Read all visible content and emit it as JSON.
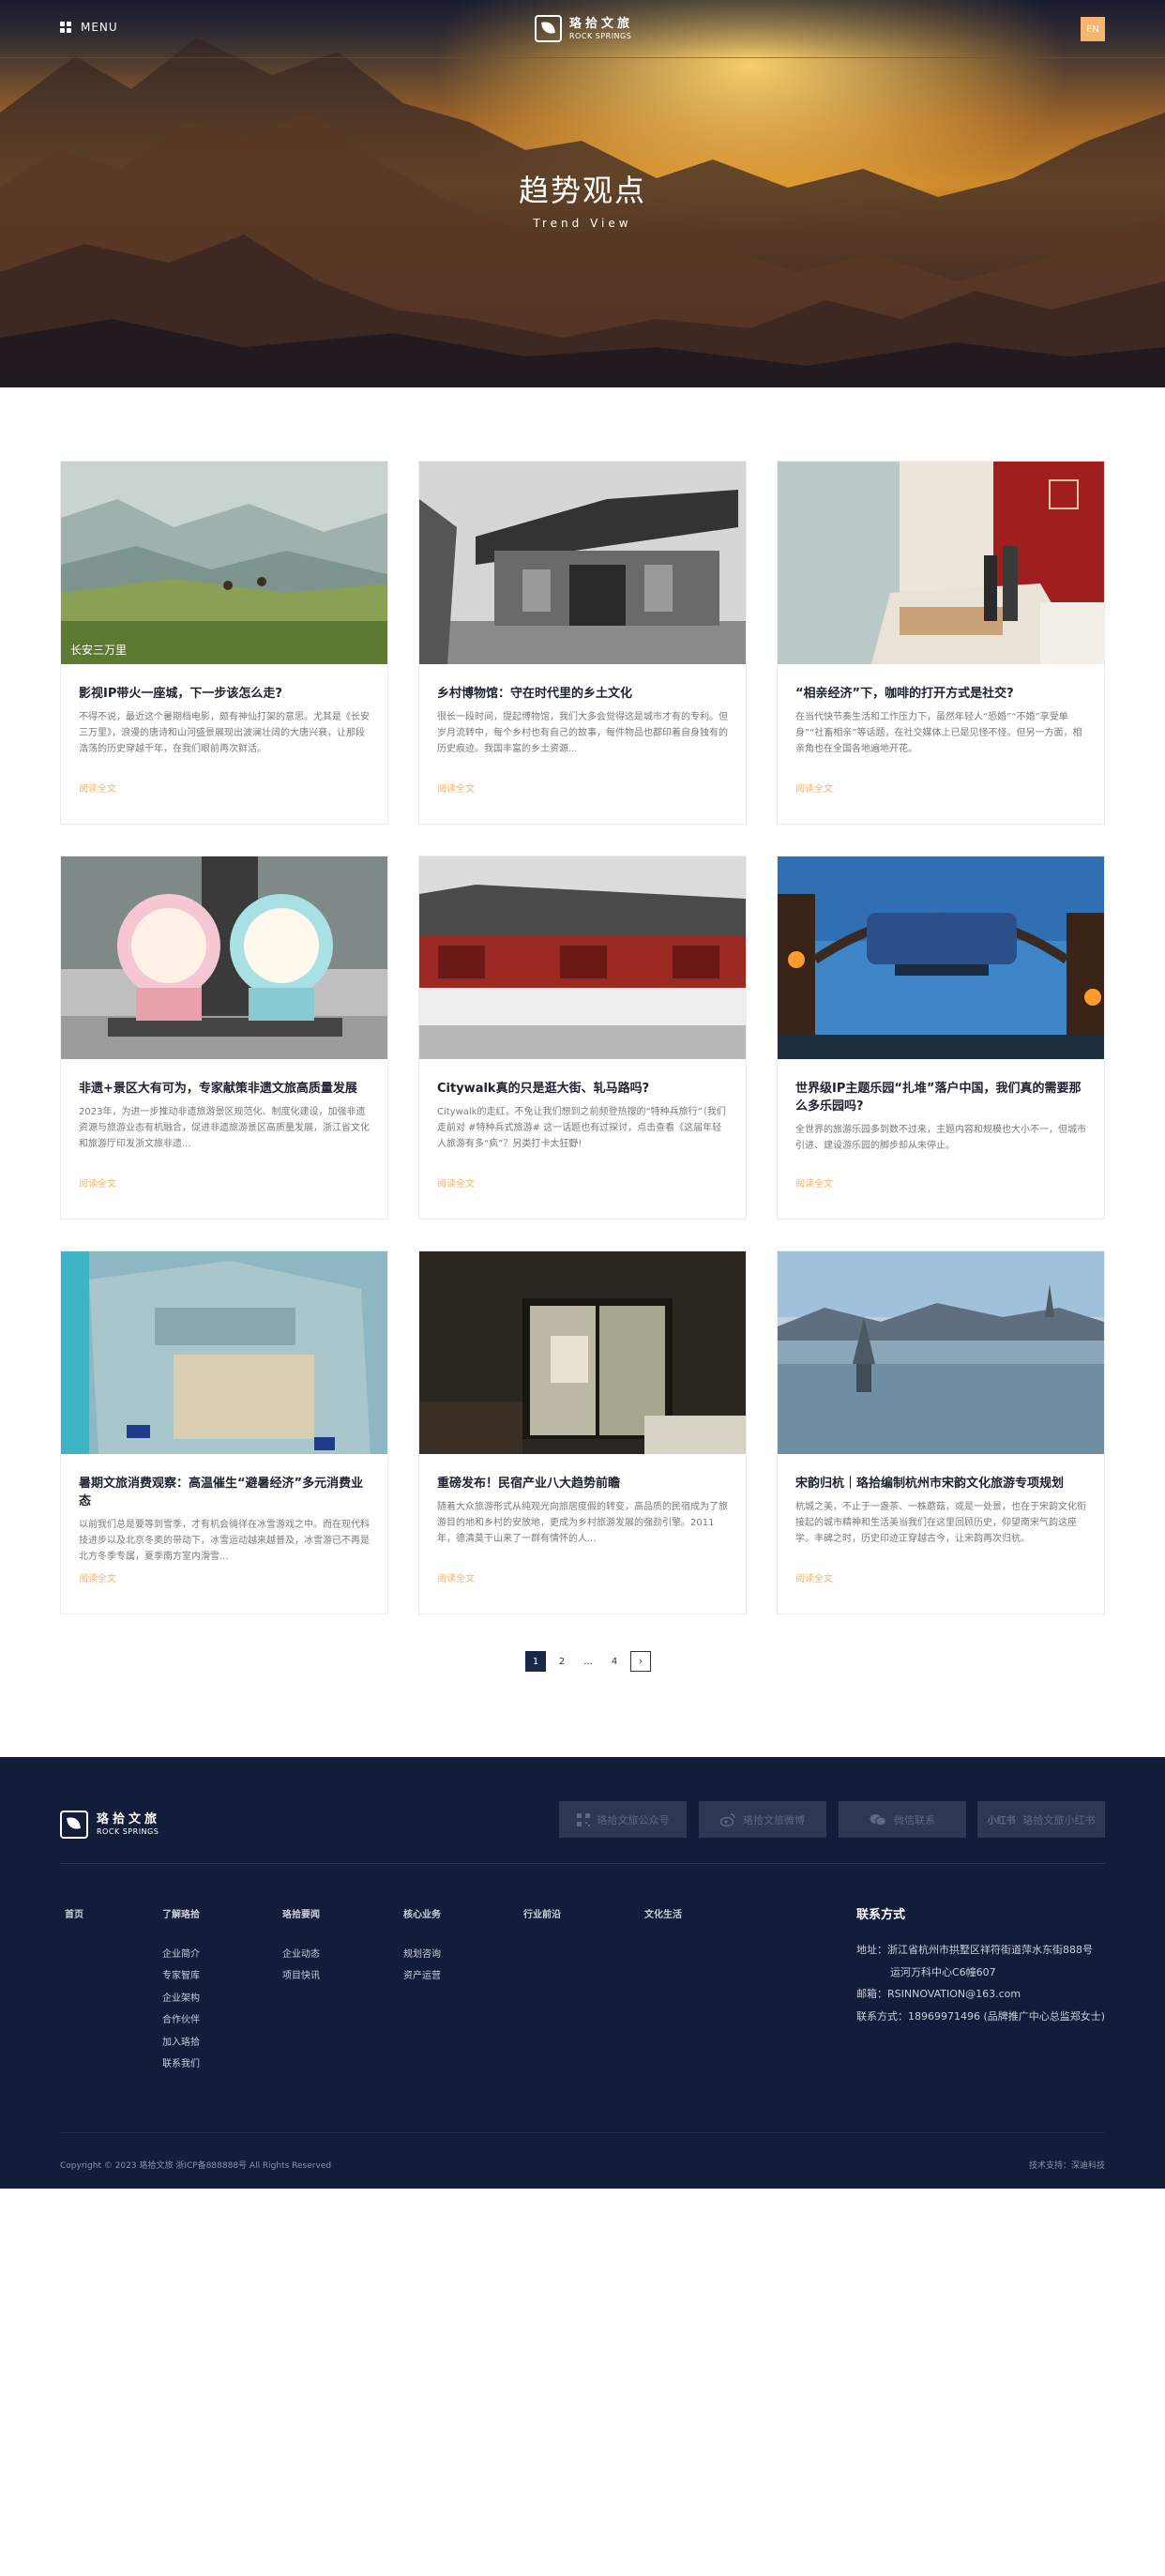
{
  "header": {
    "menu_label": "MENU",
    "logo_cn": "珞拾文旅",
    "logo_en": "ROCK SPRINGS",
    "lang_label": "EN"
  },
  "hero": {
    "title": "趋势观点",
    "subtitle": "Trend View"
  },
  "articles": [
    {
      "title": "影视IP带火一座城，下一步该怎么走?",
      "excerpt": "不得不说，最近这个暑期档电影，颇有神仙打架的意思。尤其是《长安三万里》，浪漫的唐诗和山河盛景展现出波澜壮阔的大唐兴衰，让那段浩荡的历史穿越千年，在我们眼前再次鲜活。",
      "more": "阅读全文"
    },
    {
      "title": "乡村博物馆：守在时代里的乡土文化",
      "excerpt": "很长一段时间，提起博物馆，我们大多会觉得这是城市才有的专利。但岁月流转中，每个乡村也有自己的故事，每件物品也都印着自身独有的历史痕迹。我国丰富的乡土资源...",
      "more": "阅读全文"
    },
    {
      "title": "“相亲经济”下，咖啡的打开方式是社交?",
      "excerpt": "在当代快节奏生活和工作压力下，虽然年轻人“恐婚”“不婚”享受单身”“社畜相亲”等话题，在社交媒体上已是见怪不怪。但另一方面，相亲角也在全国各地遍地开花。",
      "more": "阅读全文"
    },
    {
      "title": "非遗+景区大有可为，专家献策非遗文旅高质量发展",
      "excerpt": "2023年，为进一步推动非遗旅游景区规范化、制度化建设，加强非遗资源与旅游业态有机融合，促进非遗旅游景区高质量发展，浙江省文化和旅游厅印发浙文旅非遗...",
      "more": "阅读全文"
    },
    {
      "title": "Citywalk真的只是逛大街、轧马路吗?",
      "excerpt": "Citywalk的走红，不免让我们想到之前频登热搜的“特种兵旅行”（我们走前对 #特种兵式旅游# 这一话题也有过探讨，点击查看《这届年轻人旅游有多“疯”？另类打卡太狂野!",
      "more": "阅读全文"
    },
    {
      "title": "世界级IP主题乐园“扎堆”落户中国，我们真的需要那么多乐园吗?",
      "excerpt": "全世界的旅游乐园多到数不过来，主题内容和规模也大小不一，但城市引进、建设游乐园的脚步却从未停止。",
      "more": "阅读全文"
    },
    {
      "title": "暑期文旅消费观察：高温催生“避暑经济”多元消费业态",
      "excerpt": "以前我们总是要等到雪季，才有机会徜徉在冰雪游戏之中。而在现代科技进步以及北京冬奥的带动下，冰雪运动越来越普及，冰雪游已不再是北方冬季专属，夏季南方室内滑雪...",
      "more": "阅读全文"
    },
    {
      "title": "重磅发布！民宿产业八大趋势前瞻",
      "excerpt": "随着大众旅游形式从纯观光向旅居度假的转变，高品质的民宿成为了旅游目的地和乡村的安放地，更成为乡村旅游发展的强劲引擎。2011年，德清莫干山来了一群有情怀的人...",
      "more": "阅读全文"
    },
    {
      "title": "宋韵归杭｜珞拾编制杭州市宋韵文化旅游专项规划",
      "excerpt": "杭城之美，不止于一盏茶、一株蘑菇，或是一处景，也在于宋韵文化衔接起的城市精神和生活美当我们在这里回顾历史，仰望南宋气韵这座学。丰碑之时，历史印迹正穿越古今，让宋韵再次归杭。",
      "more": "阅读全文"
    }
  ],
  "pagination": {
    "pages": [
      "1",
      "2",
      "...",
      "4"
    ],
    "next": "›"
  },
  "footer": {
    "logo_cn": "珞拾文旅",
    "logo_en": "ROCK SPRINGS",
    "social": [
      {
        "label": "珞拾文旅公众号",
        "icon": "qrcode-icon"
      },
      {
        "label": "珞拾文旅微博",
        "icon": "weibo-icon"
      },
      {
        "label": "微信联系",
        "icon": "wechat-icon"
      },
      {
        "label": "珞拾文旅小红书",
        "prefix": "小红书",
        "icon": "xiaohongshu-icon"
      }
    ],
    "nav": [
      {
        "title": "首页",
        "items": []
      },
      {
        "title": "了解珞拾",
        "items": [
          "企业简介",
          "专家智库",
          "企业架构",
          "合作伙伴",
          "加入珞拾",
          "联系我们"
        ]
      },
      {
        "title": "珞拾要闻",
        "items": [
          "企业动态",
          "项目快讯"
        ]
      },
      {
        "title": "核心业务",
        "items": [
          "规划咨询",
          "资产运营"
        ]
      },
      {
        "title": "行业前沿",
        "items": []
      },
      {
        "title": "文化生活",
        "items": []
      }
    ],
    "contact": {
      "title": "联系方式",
      "address_1": "地址：浙江省杭州市拱墅区祥符街道萍水东街888号",
      "address_2": "运河万科中心C6幢607",
      "email": "邮箱：RSINNOVATION@163.com",
      "phone": "联系方式：18969971496 (品牌推广中心总监郑女士)"
    },
    "copyright": "Copyright © 2023 珞拾文旅 浙ICP备888888号    All Rights Reserved",
    "support": "技术支持：深迪科技"
  }
}
